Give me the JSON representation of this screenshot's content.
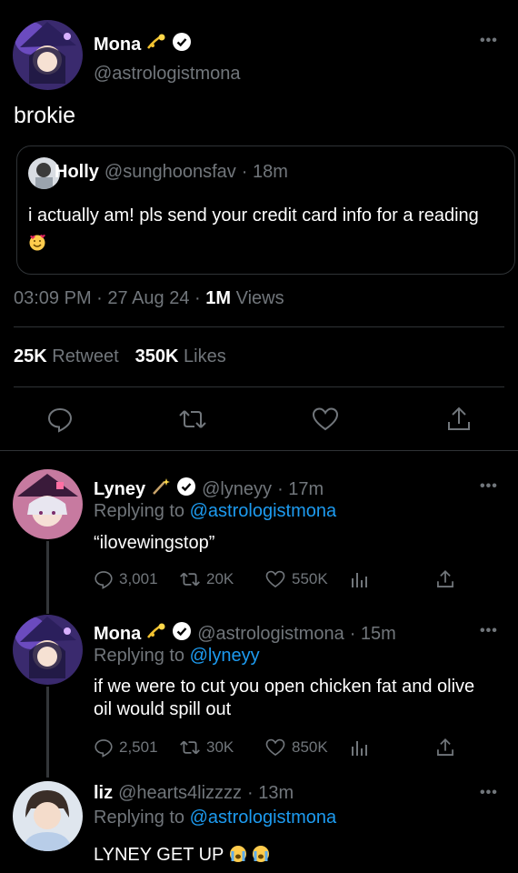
{
  "main_tweet": {
    "name": "Mona",
    "handle": "@astrologistmona",
    "text": "brokie",
    "quote": {
      "name": "Holly",
      "handle": "@sunghoonsfav",
      "time": "· 18m",
      "text": "i actually am! pls send your credit card info for a reading"
    },
    "time": "03:09 PM",
    "date": "27 Aug 24",
    "views_count": "1M",
    "views_label": "Views",
    "retweets_count": "25K",
    "retweets_label": "Retweet",
    "likes_count": "350K",
    "likes_label": "Likes"
  },
  "replies": [
    {
      "name": "Lyney",
      "handle": "@lyneyy",
      "time": "· 17m",
      "replying_prefix": "Replying to",
      "replying_to": "@astrologistmona",
      "text": "“ilovewingstop”",
      "comments": "3,001",
      "retweets": "20K",
      "likes": "550K"
    },
    {
      "name": "Mona",
      "handle": "@astrologistmona",
      "time": "· 15m",
      "replying_prefix": "Replying to",
      "replying_to": "@lyneyy",
      "text": "if we were to cut you open chicken fat and olive oil would spill out",
      "comments": "2,501",
      "retweets": "30K",
      "likes": "850K"
    },
    {
      "name": "liz",
      "handle": "@hearts4lizzzz",
      "time": "· 13m",
      "replying_prefix": "Replying to",
      "replying_to": "@astrologistmona",
      "text": "LYNEY GET UP"
    }
  ],
  "colors": {
    "background": "#000000",
    "text": "#e7e9ea",
    "muted": "#71767b",
    "link": "#1d9bf0",
    "divider": "#2f3336"
  }
}
